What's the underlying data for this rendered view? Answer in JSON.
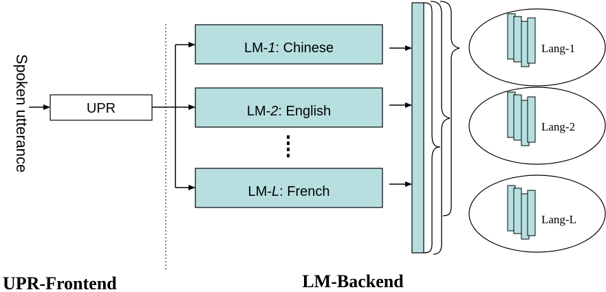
{
  "side_label": "Spoken utterance",
  "upr_box": "UPR",
  "lm_boxes": [
    {
      "prefix": "LM-",
      "index": "1",
      "suffix": ": Chinese"
    },
    {
      "prefix": "LM-",
      "index": "2",
      "suffix": ": English"
    },
    {
      "prefix": "LM-",
      "index": "L",
      "suffix": ": French"
    }
  ],
  "classifiers": [
    {
      "label": "Lang-1"
    },
    {
      "label": "Lang-2"
    },
    {
      "label": "Lang-L"
    }
  ],
  "section_labels": {
    "frontend": "UPR-Frontend",
    "backend": "LM-Backend"
  },
  "colors": {
    "box_fill": "#b7dfe0",
    "stroke": "#000000",
    "background": "#ffffff"
  }
}
